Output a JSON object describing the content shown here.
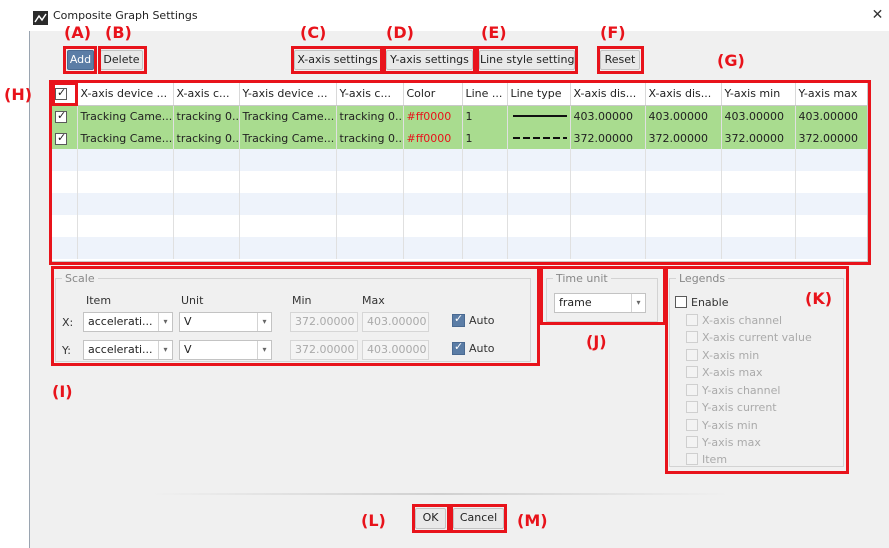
{
  "window": {
    "title": "Composite Graph Settings",
    "close_glyph": "✕"
  },
  "toolbar": {
    "add_label": "Add",
    "delete_label": "Delete",
    "xaxis_settings_label": "X-axis settings",
    "yaxis_settings_label": "Y-axis settings",
    "line_style_label": "Line style setting",
    "reset_label": "Reset"
  },
  "annotations": [
    "(A)",
    "(B)",
    "(C)",
    "(D)",
    "(E)",
    "(F)",
    "(G)",
    "(H)",
    "(I)",
    "(J)",
    "(K)",
    "(L)",
    "(M)"
  ],
  "table": {
    "columns": [
      "X-axis device ...",
      "X-axis c...",
      "Y-axis device ...",
      "Y-axis c...",
      "Color",
      "Line ...",
      "Line type",
      "X-axis dis...",
      "X-axis dis...",
      "Y-axis min",
      "Y-axis max"
    ],
    "rows": [
      [
        "Tracking Came...",
        "tracking 0...",
        "Tracking Came...",
        "tracking 0...",
        "#ff0000",
        "1",
        "",
        "403.00000",
        "403.00000",
        "403.00000",
        "403.00000"
      ],
      [
        "Tracking Came...",
        "tracking 0...",
        "Tracking Came...",
        "tracking 0...",
        "#ff0000",
        "1",
        "",
        "372.00000",
        "372.00000",
        "372.00000",
        "372.00000"
      ]
    ],
    "row_line_styles": [
      "solid",
      "dashed"
    ]
  },
  "scale": {
    "legend": "Scale",
    "header_item": "Item",
    "header_unit": "Unit",
    "header_min": "Min",
    "header_max": "Max",
    "x": {
      "label": "X:",
      "item": "accelerati...",
      "unit": "V",
      "min": "372.00000",
      "max": "403.00000",
      "auto_label": "Auto"
    },
    "y": {
      "label": "Y:",
      "item": "accelerati...",
      "unit": "V",
      "min": "372.00000",
      "max": "403.00000",
      "auto_label": "Auto"
    }
  },
  "time_unit": {
    "legend": "Time unit",
    "value": "frame"
  },
  "legends": {
    "legend": "Legends",
    "enable_label": "Enable",
    "items": [
      "X-axis channel",
      "X-axis current value",
      "X-axis min",
      "X-axis max",
      "Y-axis channel",
      "Y-axis current",
      "Y-axis min",
      "Y-axis max",
      "Item"
    ]
  },
  "footer": {
    "ok_label": "OK",
    "cancel_label": "Cancel"
  },
  "colors": {
    "selected_row": "#a9dc8f",
    "annotation_red": "#e8131b",
    "primary_button": "#5b7da6"
  }
}
